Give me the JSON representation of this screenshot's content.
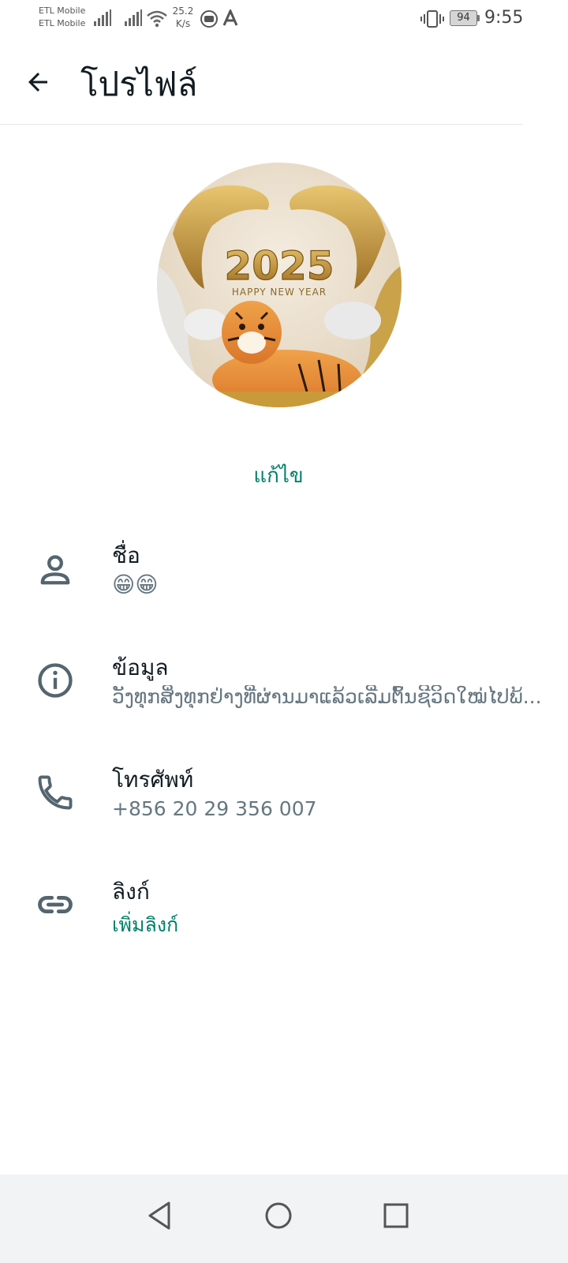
{
  "status_bar": {
    "carrier_1": "ETL Mobile",
    "carrier_2": "ETL Mobile",
    "speed_value": "25.2",
    "speed_unit": "K/s",
    "battery": "94",
    "time": "9:55"
  },
  "header": {
    "title": "โปรไฟล์"
  },
  "profile": {
    "avatar_icon": "avatar-new-year-2025",
    "avatar_text": "2025",
    "avatar_subtext": "HAPPY NEW YEAR",
    "edit_label": "แก้ไข"
  },
  "rows": [
    {
      "icon": "person-icon",
      "label": "ชื่อ",
      "value": "😁😁"
    },
    {
      "icon": "info-icon",
      "label": "ข้อมูล",
      "value": "ວັງທຸກສິ່ງທຸກຢ່າງທີ່ຜ່ານມາແລ້ວເລີ່ມຕົ້ນຊີວິດໃໝ່ໄປພ້..."
    },
    {
      "icon": "phone-icon",
      "label": "โทรศัพท์",
      "value": "+856 20 29 356 007"
    },
    {
      "icon": "link-icon",
      "label": "ลิงก์",
      "value": "เพิ่มลิงก์"
    }
  ],
  "colors": {
    "accent": "#008069",
    "text_primary": "#111b21",
    "text_secondary": "#667781"
  }
}
